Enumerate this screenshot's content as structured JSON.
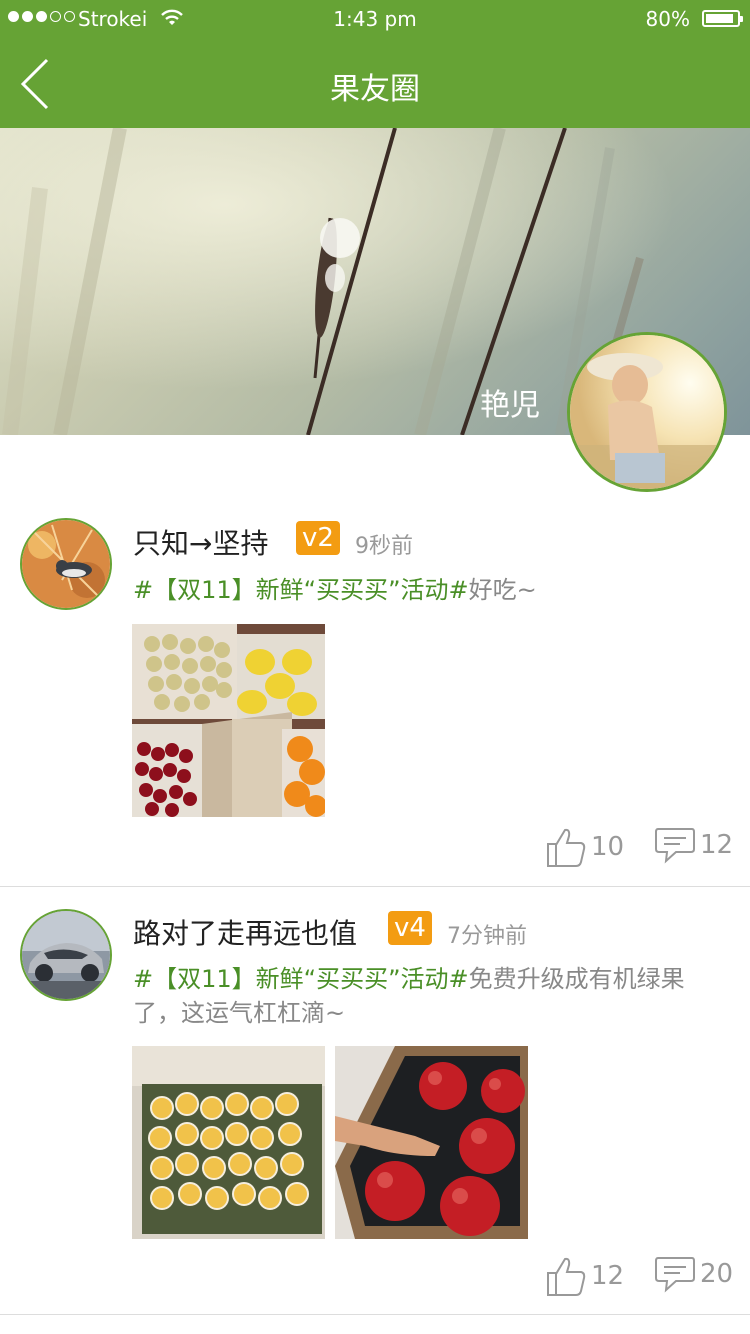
{
  "status": {
    "carrier": "Strokei",
    "time": "1:43 pm",
    "battery": "80%"
  },
  "nav": {
    "title": "果友圈"
  },
  "profile": {
    "name": "艳児"
  },
  "posts": [
    {
      "user": "只知→坚持",
      "level": "v2",
      "time": "9秒前",
      "tag": "#【双11】新鲜“买买买”活动#",
      "text": "好吃~",
      "likes": "10",
      "comments": "12"
    },
    {
      "user": "路对了走再远也值",
      "level": "v4",
      "time": "7分钟前",
      "tag": "#【双11】新鲜“买买买”活动#",
      "text": "免费升级成有机绿果了，这运气杠杠滴~",
      "likes": "12",
      "comments": "20"
    }
  ],
  "colors": {
    "brand": "#66a335",
    "tag": "#4a8f27",
    "level": "#f39c12"
  },
  "icons": [
    "back-chevron-icon",
    "thumbs-up-icon",
    "comment-bubble-icon",
    "wifi-icon",
    "battery-icon"
  ]
}
